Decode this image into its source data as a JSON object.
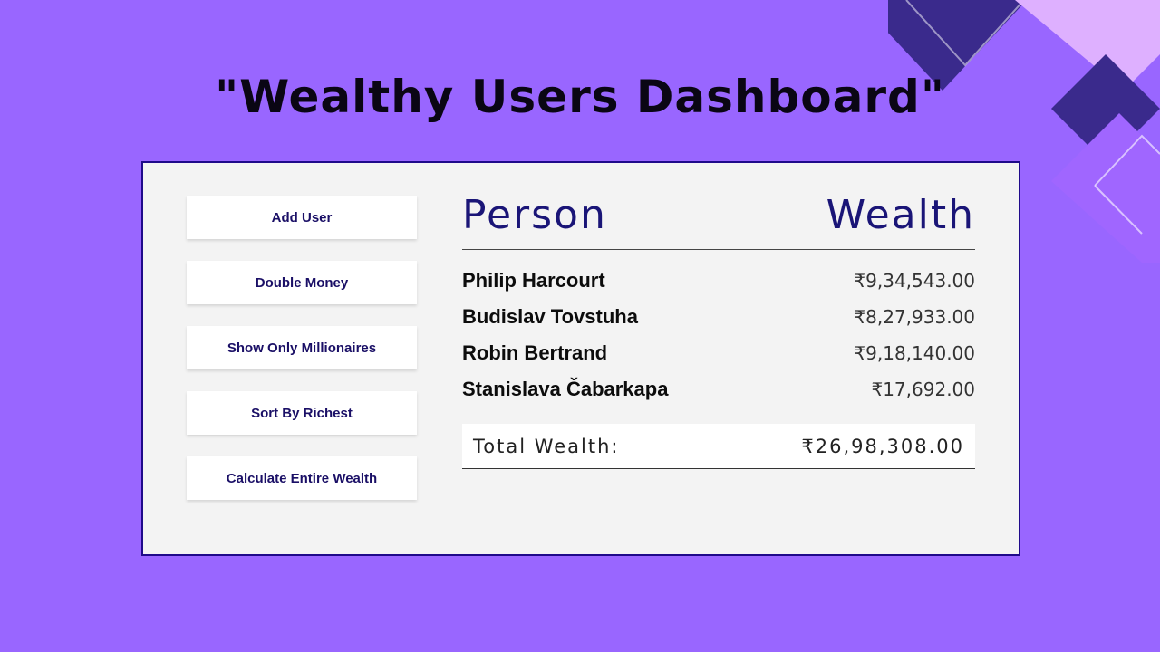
{
  "app": {
    "title": "\"Wealthy Users Dashboard\""
  },
  "colors": {
    "background": "#9966ff",
    "accent": "#1a1577",
    "panel": "#f3f3f3"
  },
  "sidebar": {
    "buttons": [
      {
        "label": "Add User"
      },
      {
        "label": "Double Money"
      },
      {
        "label": "Show Only Millionaires"
      },
      {
        "label": "Sort By Richest"
      },
      {
        "label": "Calculate Entire Wealth"
      }
    ]
  },
  "main": {
    "headers": {
      "person": "Person",
      "wealth": "Wealth"
    },
    "rows": [
      {
        "name": "Philip Harcourt",
        "wealth": "₹9,34,543.00"
      },
      {
        "name": "Budislav Tovstuha",
        "wealth": "₹8,27,933.00"
      },
      {
        "name": "Robin Bertrand",
        "wealth": "₹9,18,140.00"
      },
      {
        "name": "Stanislava Čabarkapa",
        "wealth": "₹17,692.00"
      }
    ],
    "total": {
      "label": "Total Wealth:",
      "value": "₹26,98,308.00"
    }
  }
}
